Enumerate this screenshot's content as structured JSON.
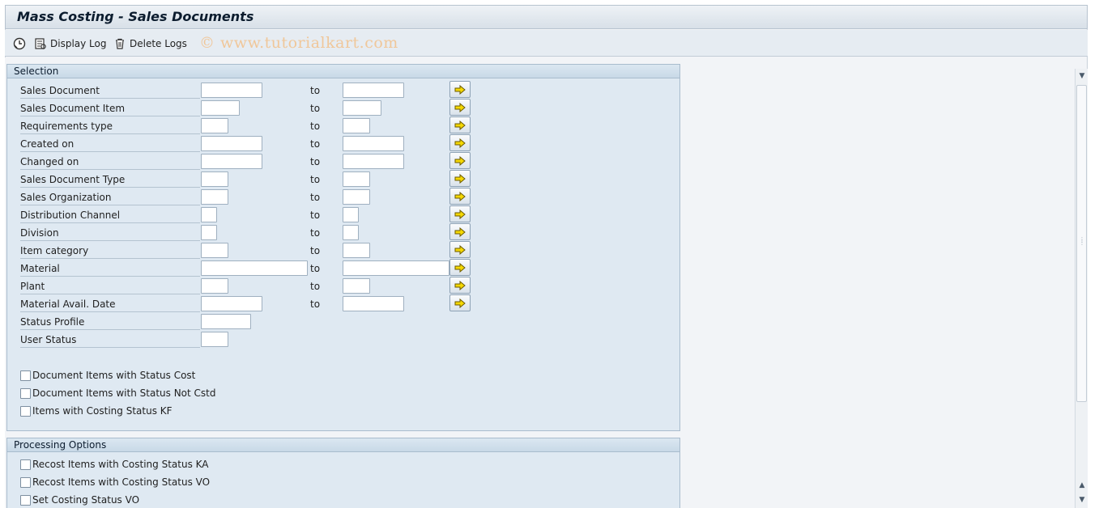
{
  "window": {
    "title": "Mass Costing - Sales Documents"
  },
  "toolbar": {
    "display_log": "Display Log",
    "delete_logs": "Delete Logs",
    "watermark": "© www.tutorialkart.com"
  },
  "selection": {
    "header": "Selection",
    "to_label": "to",
    "rows": [
      {
        "label": "Sales Document"
      },
      {
        "label": "Sales Document Item"
      },
      {
        "label": "Requirements type"
      },
      {
        "label": "Created on"
      },
      {
        "label": "Changed on"
      },
      {
        "label": "Sales Document Type"
      },
      {
        "label": "Sales Organization"
      },
      {
        "label": "Distribution Channel"
      },
      {
        "label": "Division"
      },
      {
        "label": "Item category"
      },
      {
        "label": "Material"
      },
      {
        "label": "Plant"
      },
      {
        "label": "Material Avail. Date"
      },
      {
        "label": "Status Profile"
      },
      {
        "label": "User Status"
      }
    ],
    "checkboxes": [
      {
        "label": "Document Items with Status Cost",
        "checked": false
      },
      {
        "label": "Document Items with Status Not Cstd",
        "checked": false
      },
      {
        "label": "Items with Costing Status KF",
        "checked": false
      }
    ]
  },
  "processing": {
    "header": "Processing Options",
    "checkboxes": [
      {
        "label": "Recost Items with Costing Status KA",
        "checked": false
      },
      {
        "label": "Recost Items with Costing Status VO",
        "checked": false
      },
      {
        "label": "Set Costing Status VO",
        "checked": false
      }
    ]
  },
  "colors": {
    "arrow_fill": "#f5d800",
    "arrow_stroke": "#6b5a00",
    "group_bg": "#dfe9f2"
  }
}
